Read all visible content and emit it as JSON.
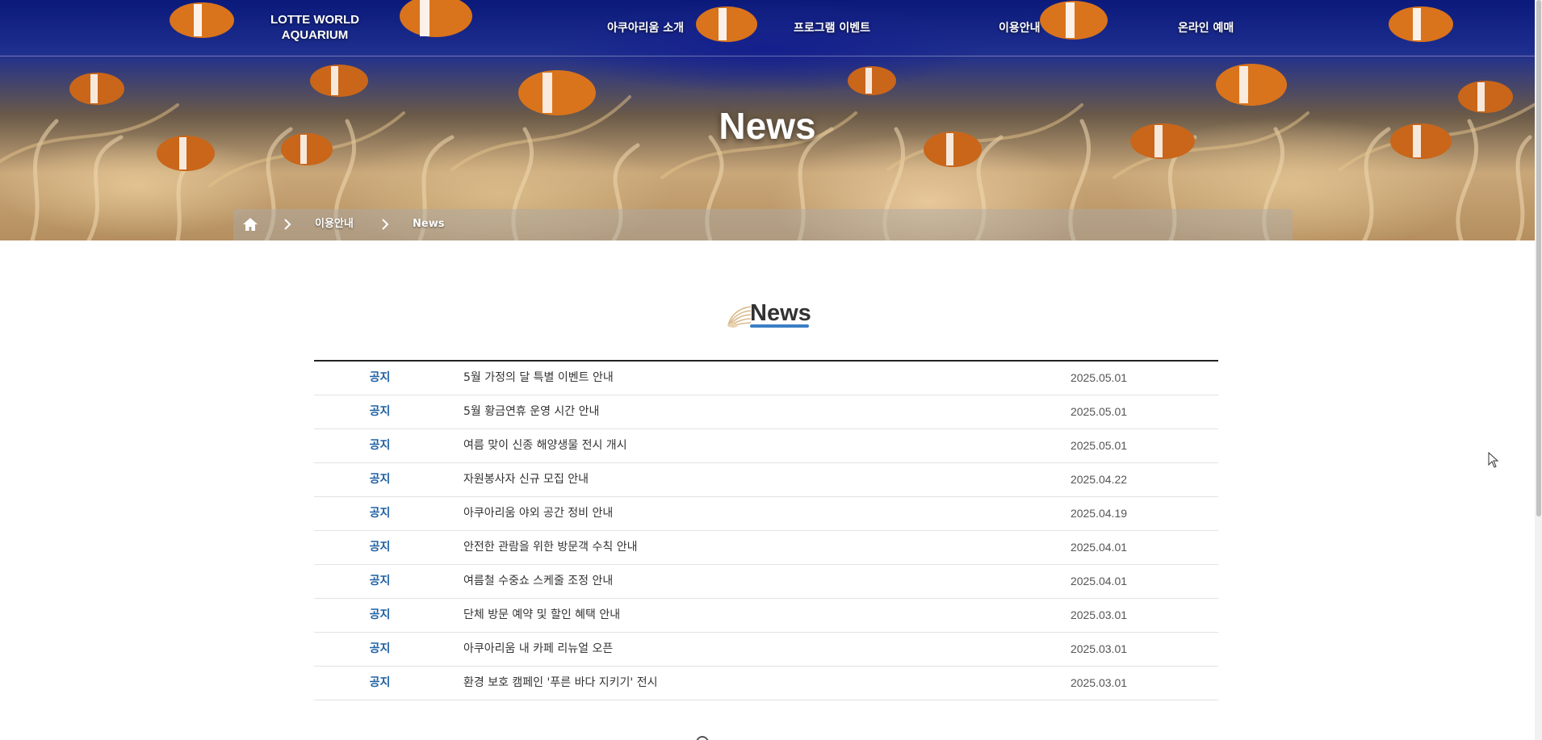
{
  "header": {
    "logo_line1": "LOTTE WORLD",
    "logo_line2": "AQUARIUM",
    "nav": [
      {
        "label": "아쿠아리움 소개"
      },
      {
        "label": "프로그램 이벤트"
      },
      {
        "label": "이용안내"
      },
      {
        "label": "온라인 예매"
      }
    ]
  },
  "hero": {
    "title": "News"
  },
  "breadcrumb": {
    "home_icon": "home-icon",
    "items": [
      "이용안내",
      "News"
    ]
  },
  "section": {
    "title": "News",
    "accent_color": "#3b7fc4"
  },
  "news": {
    "category_color": "#1d5fa3",
    "rows": [
      {
        "category": "공지",
        "subject": "5월 가정의 달 특별 이벤트 안내",
        "date": "2025.05.01"
      },
      {
        "category": "공지",
        "subject": "5월 황금연휴 운영 시간 안내",
        "date": "2025.05.01"
      },
      {
        "category": "공지",
        "subject": "여름 맞이 신종 해양생물 전시 개시",
        "date": "2025.05.01"
      },
      {
        "category": "공지",
        "subject": "자원봉사자 신규 모집 안내",
        "date": "2025.04.22"
      },
      {
        "category": "공지",
        "subject": "아쿠아리움 야외 공간 정비 안내",
        "date": "2025.04.19"
      },
      {
        "category": "공지",
        "subject": "안전한 관람을 위한 방문객 수칙 안내",
        "date": "2025.04.01"
      },
      {
        "category": "공지",
        "subject": "여름철 수중쇼 스케줄 조정 안내",
        "date": "2025.04.01"
      },
      {
        "category": "공지",
        "subject": "단체 방문 예약 및 할인 혜택 안내",
        "date": "2025.03.01"
      },
      {
        "category": "공지",
        "subject": "아쿠아리움 내 카페 리뉴얼 오픈",
        "date": "2025.03.01"
      },
      {
        "category": "공지",
        "subject": "환경 보호 캠페인 '푸른 바다 지키기' 전시",
        "date": "2025.03.01"
      }
    ]
  }
}
